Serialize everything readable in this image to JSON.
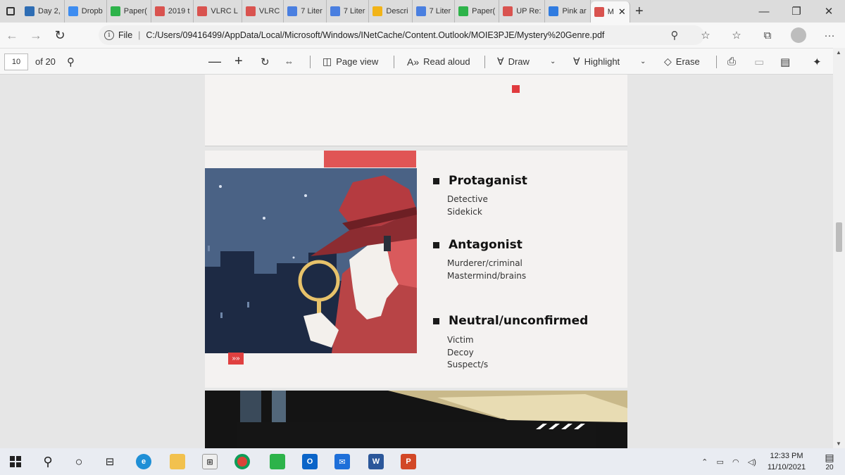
{
  "tabs": [
    {
      "label": "Day 2,",
      "color": "#2e6db4"
    },
    {
      "label": "Dropb",
      "color": "#3d8cf0"
    },
    {
      "label": "Paper(",
      "color": "#2db34a"
    },
    {
      "label": "2019 t",
      "color": "#d9534f"
    },
    {
      "label": "VLRC L",
      "color": "#d9534f"
    },
    {
      "label": "VLRC",
      "color": "#d9534f"
    },
    {
      "label": "7 Liter",
      "color": "#4a7fe0"
    },
    {
      "label": "7 Liter",
      "color": "#4a7fe0"
    },
    {
      "label": "Descri",
      "color": "#f2b418"
    },
    {
      "label": "7 Liter",
      "color": "#4a7fe0"
    },
    {
      "label": "Paper(",
      "color": "#2db34a"
    },
    {
      "label": "UP Re:",
      "color": "#d9534f"
    },
    {
      "label": "Pink ar",
      "color": "#2f7be0"
    },
    {
      "label": "M",
      "color": "#d9534f",
      "active": true
    }
  ],
  "tab_close": "✕",
  "new_tab": "+",
  "window": {
    "minimize": "—",
    "restore": "❐",
    "close": "✕"
  },
  "address": {
    "file_label": "File",
    "url": "C:/Users/09416499/AppData/Local/Microsoft/Windows/INetCache/Content.Outlook/MOIE3PJE/Mystery%20Genre.pdf"
  },
  "pdf_toolbar": {
    "page_number": "10",
    "page_total": "of 20",
    "page_view": "Page view",
    "read_aloud": "Read aloud",
    "draw": "Draw",
    "highlight": "Highlight",
    "erase": "Erase"
  },
  "slide": {
    "sections": [
      {
        "heading": "Protaganist",
        "items": [
          "Detective",
          "Sidekick"
        ]
      },
      {
        "heading": "Antagonist",
        "items": [
          "Murderer/criminal",
          "Mastermind/brains"
        ]
      },
      {
        "heading": "Neutral/unconfirmed",
        "items": [
          "Victim",
          "Decoy",
          "Suspect/s"
        ]
      }
    ],
    "arrow_tag": "»»",
    "accent_color": "#e05555"
  },
  "taskbar": {
    "time": "12:33 PM",
    "date": "11/10/2021",
    "notifications": "20"
  }
}
